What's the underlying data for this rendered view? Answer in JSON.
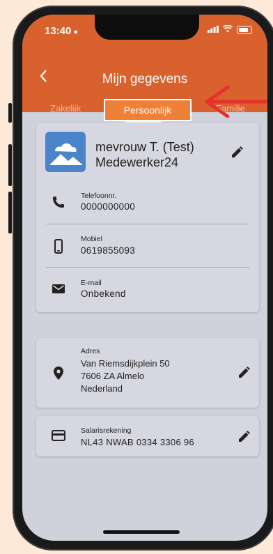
{
  "status": {
    "time": "13:40"
  },
  "header": {
    "title": "Mijn gegevens",
    "tabs": [
      {
        "label": "Zakelijk"
      },
      {
        "label": "Persoonlijk"
      },
      {
        "label": "Familie"
      }
    ],
    "active_tab": "Persoonlijk"
  },
  "profile": {
    "name_line1": "mevrouw T. (Test)",
    "name_line2": "Medewerker24"
  },
  "contact": {
    "phone": {
      "label": "Telefoonnr.",
      "value": "0000000000"
    },
    "mobile": {
      "label": "Mobiel",
      "value": "0619855093"
    },
    "email": {
      "label": "E-mail",
      "value": "Onbekend"
    }
  },
  "address": {
    "label": "Adres",
    "line1": "Van Riemsdijkplein 50",
    "line2": "7606 ZA Almelo",
    "line3": "Nederland"
  },
  "bank": {
    "label": "Salarisrekening",
    "value": "NL43 NWAB 0334 3306 96"
  },
  "colors": {
    "header": "#d9612d",
    "active_tab": "#f08038",
    "avatar": "#4a84c9",
    "annotation_arrow": "#e8302a",
    "page_background": "#fde9d8"
  },
  "icons": [
    "back-arrow-icon",
    "phone-icon",
    "mobile-icon",
    "mail-icon",
    "location-pin-icon",
    "credit-card-icon",
    "edit-pencil-icon",
    "image-placeholder-icon"
  ]
}
